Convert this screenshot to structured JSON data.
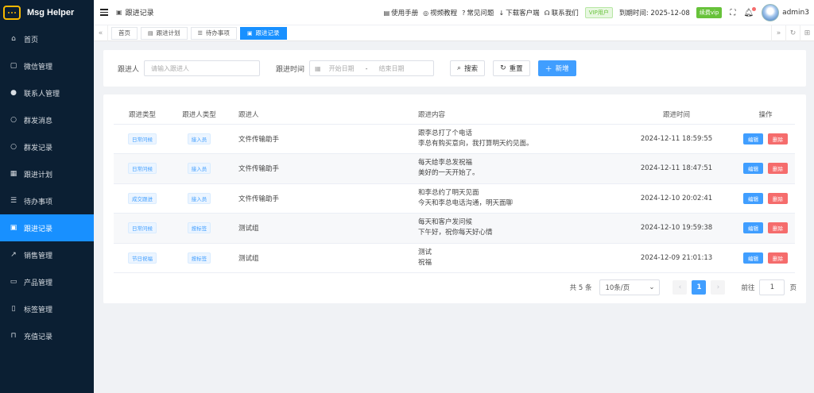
{
  "app": {
    "name": "Msg Helper"
  },
  "sidebar": {
    "items": [
      {
        "label": "首页",
        "icon": "home-icon",
        "glyph": "⌂"
      },
      {
        "label": "微信管理",
        "icon": "chat-icon",
        "glyph": "▢"
      },
      {
        "label": "联系人管理",
        "icon": "user-icon",
        "glyph": "●"
      },
      {
        "label": "群发消息",
        "icon": "message-icon",
        "glyph": "○"
      },
      {
        "label": "群发记录",
        "icon": "message-record-icon",
        "glyph": "○"
      },
      {
        "label": "跟进计划",
        "icon": "calendar-icon",
        "glyph": "▦"
      },
      {
        "label": "待办事项",
        "icon": "list-icon",
        "glyph": "☰"
      },
      {
        "label": "跟进记录",
        "icon": "briefcase-icon",
        "glyph": "▣",
        "active": true
      },
      {
        "label": "销售管理",
        "icon": "trend-icon",
        "glyph": "↗"
      },
      {
        "label": "产品管理",
        "icon": "box-icon",
        "glyph": "▭"
      },
      {
        "label": "标签管理",
        "icon": "bookmark-icon",
        "glyph": "▯"
      },
      {
        "label": "充值记录",
        "icon": "bag-icon",
        "glyph": "⊓"
      }
    ]
  },
  "header": {
    "breadcrumb": "跟进记录",
    "links": [
      {
        "label": "使用手册",
        "glyph": "▤"
      },
      {
        "label": "视频教程",
        "glyph": "◎"
      },
      {
        "label": "常见问题",
        "glyph": "?"
      },
      {
        "label": "下载客户端",
        "glyph": "↓"
      },
      {
        "label": "联系我们",
        "glyph": "☊"
      }
    ],
    "vip_badge": "VIP用户",
    "expire": "到期时间: 2025-12-08",
    "renew_label": "续费vip",
    "username": "admin3"
  },
  "tags": [
    {
      "label": "首页",
      "glyph": ""
    },
    {
      "label": "跟进计划",
      "glyph": "▤"
    },
    {
      "label": "待办事项",
      "glyph": "☰"
    },
    {
      "label": "跟进记录",
      "glyph": "▣",
      "active": true
    }
  ],
  "filter": {
    "follower_label": "跟进人",
    "follower_placeholder": "请输入跟进人",
    "time_label": "跟进时间",
    "start_placeholder": "开始日期",
    "range_sep": "-",
    "end_placeholder": "结束日期",
    "search_label": "搜索",
    "reset_label": "重置",
    "add_label": "新增"
  },
  "table": {
    "headers": [
      "跟进类型",
      "跟进人类型",
      "跟进人",
      "跟进内容",
      "跟进时间",
      "操作"
    ],
    "edit_label": "编辑",
    "delete_label": "删除",
    "rows": [
      {
        "type": "日常问候",
        "person_type": "接入员",
        "person": "文件传输助手",
        "content1": "跟李总打了个电话",
        "content2": "李总有购买意向，我打算明天约见面。",
        "time": "2024-12-11 18:59:55"
      },
      {
        "type": "日常问候",
        "person_type": "接入员",
        "person": "文件传输助手",
        "content1": "每天给李总发祝福",
        "content2": "美好的一天开始了。",
        "time": "2024-12-11 18:47:51"
      },
      {
        "type": "成交跟进",
        "person_type": "接入员",
        "person": "文件传输助手",
        "content1": "和李总约了明天见面",
        "content2": "今天和李总电话沟通，明天面聊",
        "time": "2024-12-10 20:02:41"
      },
      {
        "type": "日常问候",
        "person_type": "按标签",
        "person": "测试组",
        "content1": "每天和客户发问候",
        "content2": "下午好，祝你每天好心情",
        "time": "2024-12-10 19:59:38"
      },
      {
        "type": "节日祝福",
        "person_type": "按标签",
        "person": "测试组",
        "content1": "测试",
        "content2": "祝福",
        "time": "2024-12-09 21:01:13"
      }
    ]
  },
  "pagination": {
    "total": "共 5 条",
    "page_size": "10条/页",
    "current": "1",
    "goto_label": "前往",
    "goto_value": "1",
    "page_unit": "页"
  }
}
